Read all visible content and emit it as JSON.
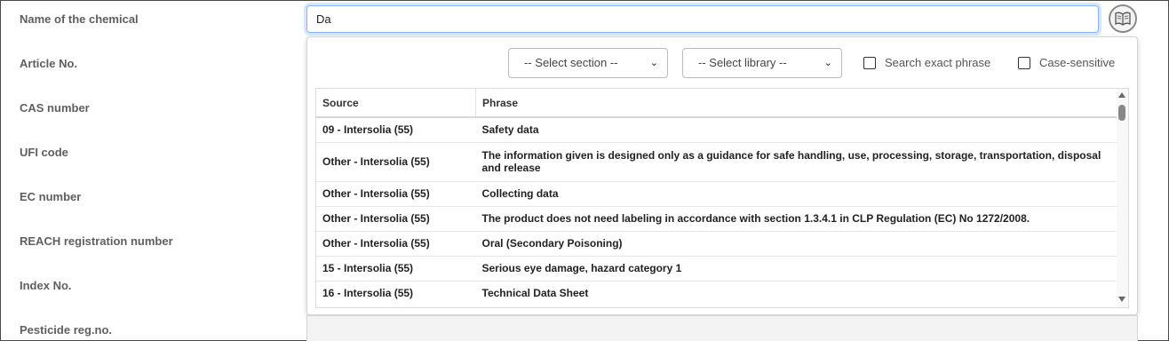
{
  "form": {
    "labels": [
      "Name of the chemical",
      "Article No.",
      "CAS number",
      "UFI code",
      "EC number",
      "REACH registration number",
      "Index No.",
      "Pesticide reg.no."
    ],
    "name_value": "Da"
  },
  "dropdown": {
    "section_select": "-- Select section --",
    "library_select": "-- Select library --",
    "exact_phrase_label": "Search exact phrase",
    "case_sensitive_label": "Case-sensitive",
    "columns": [
      "Source",
      "Phrase"
    ],
    "rows": [
      {
        "source": "09 - Intersolia (55)",
        "phrase": "Safety data"
      },
      {
        "source": "Other - Intersolia (55)",
        "phrase": "The information given is designed only as a guidance for safe handling, use, processing, storage, transportation, disposal and release"
      },
      {
        "source": "Other - Intersolia (55)",
        "phrase": "Collecting data"
      },
      {
        "source": "Other - Intersolia (55)",
        "phrase": "The product does not need labeling in accordance with section 1.3.4.1 in CLP Regulation (EC) No 1272/2008."
      },
      {
        "source": "Other - Intersolia (55)",
        "phrase": "Oral (Secondary Poisoning)"
      },
      {
        "source": "15 - Intersolia (55)",
        "phrase": "Serious eye damage, hazard category 1"
      },
      {
        "source": "16 - Intersolia (55)",
        "phrase": "Technical Data Sheet"
      }
    ]
  },
  "colors": {
    "focus": "#86b7fe",
    "label": "#5f5f5f"
  },
  "icons": {
    "library_button": "book-icon"
  }
}
